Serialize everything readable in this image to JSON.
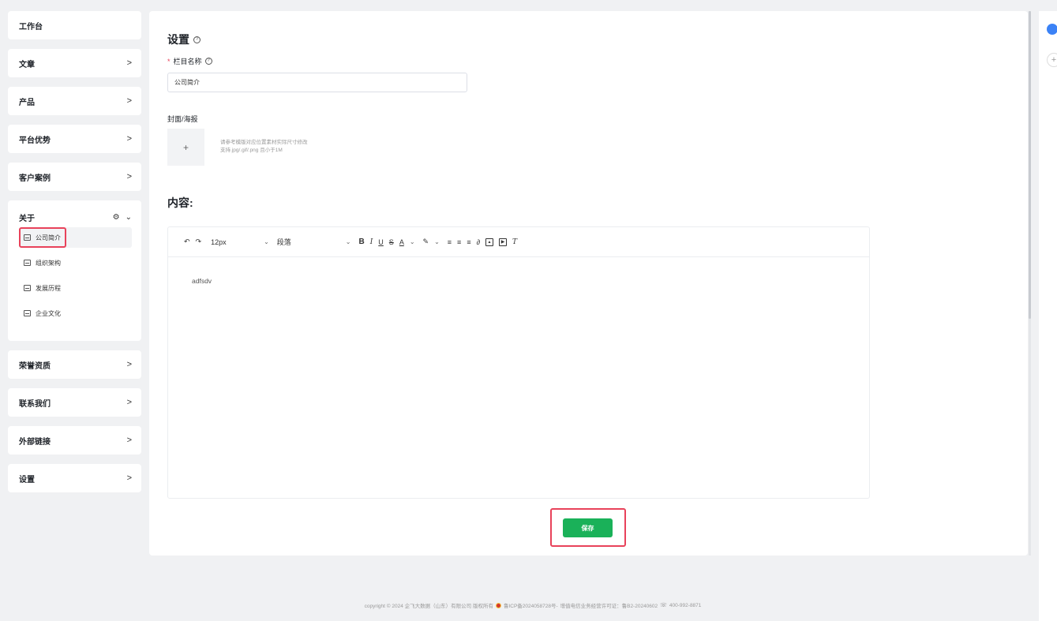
{
  "sidebar": {
    "items_top": [
      {
        "label": "工作台",
        "chevron": ""
      },
      {
        "label": "文章",
        "chevron": ">"
      },
      {
        "label": "产品",
        "chevron": ">"
      },
      {
        "label": "平台优势",
        "chevron": ">"
      },
      {
        "label": "客户案例",
        "chevron": ">"
      }
    ],
    "group": {
      "label": "关于",
      "gear": "⚙",
      "caret": "⌄",
      "active": {
        "label": "公司简介",
        "icon": "document-icon"
      },
      "subitems": [
        {
          "label": "组织架构",
          "icon": "org-icon"
        },
        {
          "label": "发展历程",
          "icon": "history-icon"
        },
        {
          "label": "企业文化",
          "icon": "culture-icon"
        }
      ]
    },
    "items_bottom": [
      {
        "label": "荣誉资质",
        "chevron": ">"
      },
      {
        "label": "联系我们",
        "chevron": ">"
      },
      {
        "label": "外部链接",
        "chevron": ">"
      },
      {
        "label": "设置",
        "chevron": ">"
      }
    ]
  },
  "main": {
    "title": "设置",
    "help_icon": "?",
    "field_label": "栏目名称",
    "required_mark": "*",
    "field_value": "公司简介",
    "cover_label": "封面/海报",
    "upload_plus": "+",
    "upload_hint_1": "请参考模版对应位置素材实际尺寸修改",
    "upload_hint_2": "支持.jpg/.gif/.png 且小于1M",
    "content_title": "内容:",
    "editor": {
      "font_size": "12px",
      "paragraph": "段落",
      "caret": "⌄",
      "body": "adfsdv"
    },
    "save_label": "保存"
  },
  "footer": {
    "text_1": "copyright © 2024 企飞大数据（山东）有限公司 版权所有",
    "text_2": "鲁ICP备2024058728号-",
    "text_3": "增值电信业务经营许可证：鲁B2-20240602",
    "phone": "400-992-8871"
  },
  "colors": {
    "accent_green": "#1ab159",
    "highlight_red": "#e8425a",
    "background": "#f0f1f3"
  }
}
